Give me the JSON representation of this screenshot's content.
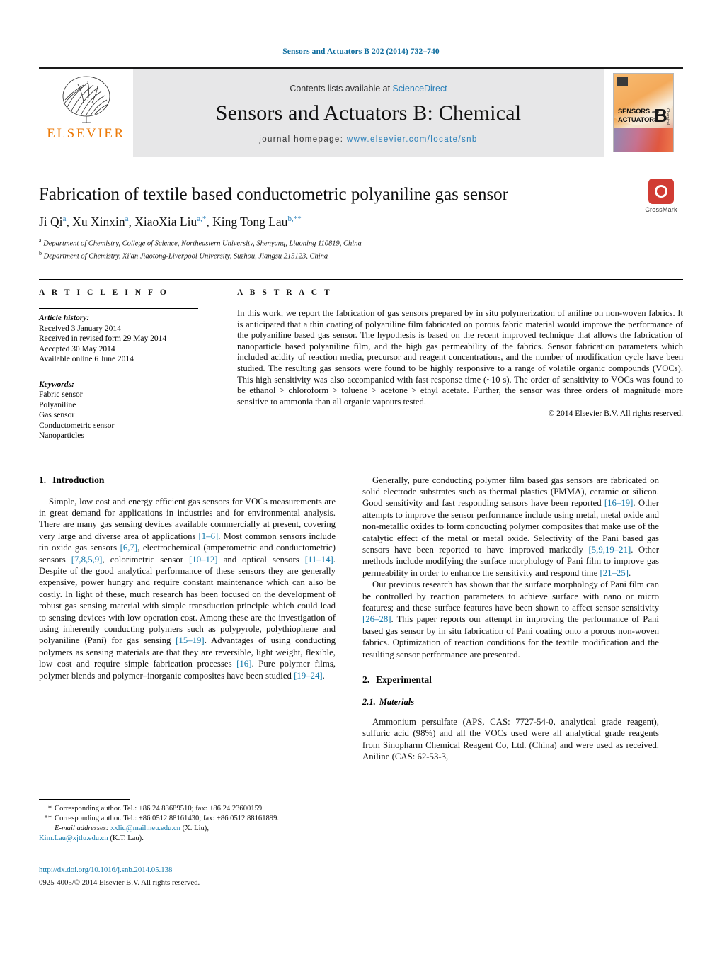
{
  "running_head": "Sensors and Actuators B 202 (2014) 732–740",
  "masthead": {
    "publisher": "ELSEVIER",
    "contents_prefix": "Contents lists available at ",
    "contents_link": "ScienceDirect",
    "journal_title": "Sensors and Actuators B: Chemical",
    "homepage_label": "journal homepage:",
    "homepage_url": "www.elsevier.com/locate/snb",
    "cover_line1": "SENSORS",
    "cover_and": "and",
    "cover_line2": "ACTUATORS",
    "cover_b": "B",
    "cover_bsub": "Chemical"
  },
  "article": {
    "title": "Fabrication of textile based conductometric polyaniline gas sensor",
    "authors_plain": "Ji Qi a, Xu Xinxin a, XiaoXia Liu a,*, King Tong Lau b,**",
    "authors": [
      {
        "name": "Ji Qi",
        "marks": "a"
      },
      {
        "name": "Xu Xinxin",
        "marks": "a"
      },
      {
        "name": "XiaoXia Liu",
        "marks": "a,*"
      },
      {
        "name": "King Tong Lau",
        "marks": "b,**"
      }
    ],
    "affiliations": [
      {
        "mark": "a",
        "text": "Department of Chemistry, College of Science, Northeastern University, Shenyang, Liaoning 110819, China"
      },
      {
        "mark": "b",
        "text": "Department of Chemistry, Xi'an Jiaotong-Liverpool University, Suzhou, Jiangsu 215123, China"
      }
    ],
    "crossmark_label": "CrossMark"
  },
  "article_info": {
    "heading": "A R T I C L E    I N F O",
    "history_label": "Article history:",
    "history": [
      "Received 3 January 2014",
      "Received in revised form 29 May 2014",
      "Accepted 30 May 2014",
      "Available online 6 June 2014"
    ],
    "keywords_label": "Keywords:",
    "keywords": [
      "Fabric sensor",
      "Polyaniline",
      "Gas sensor",
      "Conductometric sensor",
      "Nanoparticles"
    ]
  },
  "abstract": {
    "heading": "A B S T R A C T",
    "text": "In this work, we report the fabrication of gas sensors prepared by in situ polymerization of aniline on non-woven fabrics. It is anticipated that a thin coating of polyaniline film fabricated on porous fabric material would improve the performance of the polyaniline based gas sensor. The hypothesis is based on the recent improved technique that allows the fabrication of nanoparticle based polyaniline film, and the high gas permeability of the fabrics. Sensor fabrication parameters which included acidity of reaction media, precursor and reagent concentrations, and the number of modification cycle have been studied. The resulting gas sensors were found to be highly responsive to a range of volatile organic compounds (VOCs). This high sensitivity was also accompanied with fast response time (~10 s). The order of sensitivity to VOCs was found to be ethanol > chloroform > toluene > acetone > ethyl acetate. Further, the sensor was three orders of magnitude more sensitive to ammonia than all organic vapours tested.",
    "copyright": "© 2014 Elsevier B.V. All rights reserved."
  },
  "sections": {
    "introduction": {
      "number": "1.",
      "title": "Introduction",
      "p1": "Simple, low cost and energy efficient gas sensors for VOCs measurements are in great demand for applications in industries and for environmental analysis. There are many gas sensing devices available commercially at present, covering very large and diverse area of applications [1–6]. Most common sensors include tin oxide gas sensors [6,7], electrochemical (amperometric and conductometric) sensors [7,8,5,9], colorimetric sensor [10–12] and optical sensors [11–14]. Despite of the good analytical performance of these sensors they are generally expensive, power hungry and require constant maintenance which can also be costly. In light of these, much research has been focused on the development of robust gas sensing material with simple transduction principle which could lead to sensing devices with low operation cost. Among these are the investigation of using inherently conducting polymers such as polypyrole, polythiophene and polyaniline (Pani) for gas sensing [15–19]. Advantages of using conducting polymers as sensing materials are that they are reversible, light weight, flexible, low cost and require simple fabrication processes [16]. Pure polymer films, polymer blends and polymer–inorganic composites have been studied [19–24].",
      "p2": "Generally, pure conducting polymer film based gas sensors are fabricated on solid electrode substrates such as thermal plastics (PMMA), ceramic or silicon. Good sensitivity and fast responding sensors have been reported [16–19]. Other attempts to improve the sensor performance include using metal, metal oxide and non-metallic oxides to form conducting polymer composites that make use of the catalytic effect of the metal or metal oxide. Selectivity of the Pani based gas sensors have been reported to have improved markedly [5,9,19–21]. Other methods include modifying the surface morphology of Pani film to improve gas permeability in order to enhance the sensitivity and respond time [21–25].",
      "p3": "Our previous research has shown that the surface morphology of Pani film can be controlled by reaction parameters to achieve surface with nano or micro features; and these surface features have been shown to affect sensor sensitivity [26–28]. This paper reports our attempt in improving the performance of Pani based gas sensor by in situ fabrication of Pani coating onto a porous non-woven fabrics. Optimization of reaction conditions for the textile modification and the resulting sensor performance are presented."
    },
    "experimental": {
      "number": "2.",
      "title": "Experimental",
      "materials": {
        "number": "2.1.",
        "title": "Materials",
        "p1": "Ammonium persulfate (APS, CAS: 7727-54-0, analytical grade reagent), sulfuric acid (98%) and all the VOCs used were all analytical grade reagents from Sinopharm Chemical Reagent Co, Ltd. (China) and were used as received. Aniline (CAS: 62-53-3,"
      }
    }
  },
  "footnotes": {
    "star1": "*",
    "star1_text": "Corresponding author. Tel.: +86 24 83689510; fax: +86 24 23600159.",
    "star2": "**",
    "star2_text": "Corresponding author. Tel.: +86 0512 88161430; fax: +86 0512 88161899.",
    "email_label": "E-mail addresses:",
    "email1": "xxliu@mail.neu.edu.cn",
    "email1_owner": "(X. Liu),",
    "email2": "Kim.Lau@xjtlu.edu.cn",
    "email2_owner": "(K.T. Lau).",
    "doi": "http://dx.doi.org/10.1016/j.snb.2014.05.138",
    "issn": "0925-4005/© 2014 Elsevier B.V. All rights reserved."
  },
  "colors": {
    "link": "#1277a8",
    "running_head": "#0b6a9c",
    "elsevier_orange": "#ec7a08",
    "crossmark_red": "#d13c34",
    "panel_gray": "#e7e7e8"
  }
}
